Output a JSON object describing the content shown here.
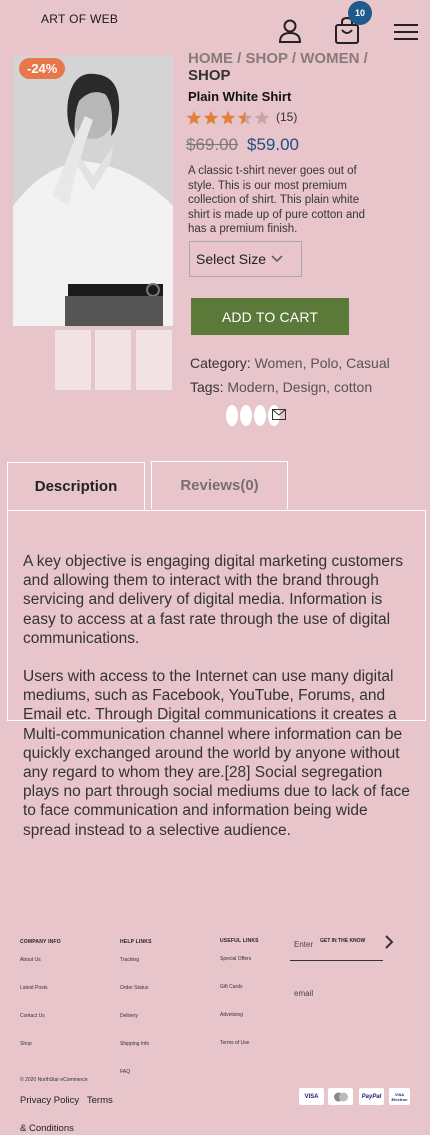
{
  "header": {
    "brand": "ART OF WEB",
    "cart_count": "10"
  },
  "product": {
    "discount": "-24%",
    "breadcrumb_path": "HOME / SHOP / WOMEN /",
    "breadcrumb_current": "SHOP",
    "title": "Plain White Shirt",
    "rating": 3.5,
    "reviews_count": "(15)",
    "old_price": "$69.00",
    "new_price": "$59.00",
    "short_description": "A classic t-shirt never goes out of style. This is our most premium collection of shirt. This plain white shirt is made up of pure cotton and has a premium finish.",
    "size_select": "Select Size",
    "add_to_cart": "ADD TO CART",
    "category_label": "Category:",
    "category_value": "Women, Polo, Casual",
    "tags_label": "Tags:",
    "tags_value": "Modern, Design, cotton"
  },
  "tabs": {
    "description": "Description",
    "reviews": "Reviews(0)"
  },
  "description": {
    "p1": "A key objective is engaging digital marketing customers and allowing them to interact with the brand through servicing and delivery of digital media. Information is easy to access at a fast rate through the use of digital communications.",
    "p2": "Users with access to the Internet can use many digital mediums, such as Facebook, YouTube, Forums, and Email etc. Through Digital communications it creates a Multi-communication channel where information can be quickly exchanged around the world by anyone without any regard to whom they are.[28] Social segregation plays no part through social mediums due to lack of face to face communication and information being wide spread instead to a selective audience."
  },
  "footer": {
    "company": {
      "heading": "COMPANY INFO",
      "links": [
        "About Us",
        "Latest Posts",
        "Contact Us",
        "Shop"
      ]
    },
    "help": {
      "heading": "HELP LINKS",
      "links": [
        "Tracking",
        "Order Status",
        "Delivery",
        "Shipping Info",
        "FAQ"
      ]
    },
    "useful": {
      "heading": "USEFUL LINKS",
      "links": [
        "Special Offers",
        "Gift Cards",
        "Advetising",
        "Terms of Use"
      ]
    },
    "newsletter_placeholder": "Enter",
    "newsletter_heading": "GET IN THE KNOW",
    "email_label": "email",
    "copyright": "© 2020 NorthStar eCommerce",
    "privacy": "Privacy Policy",
    "terms": "Terms & Conditions",
    "payments": [
      "VISA",
      "MC",
      "PayPal",
      "VISA Electron"
    ]
  }
}
